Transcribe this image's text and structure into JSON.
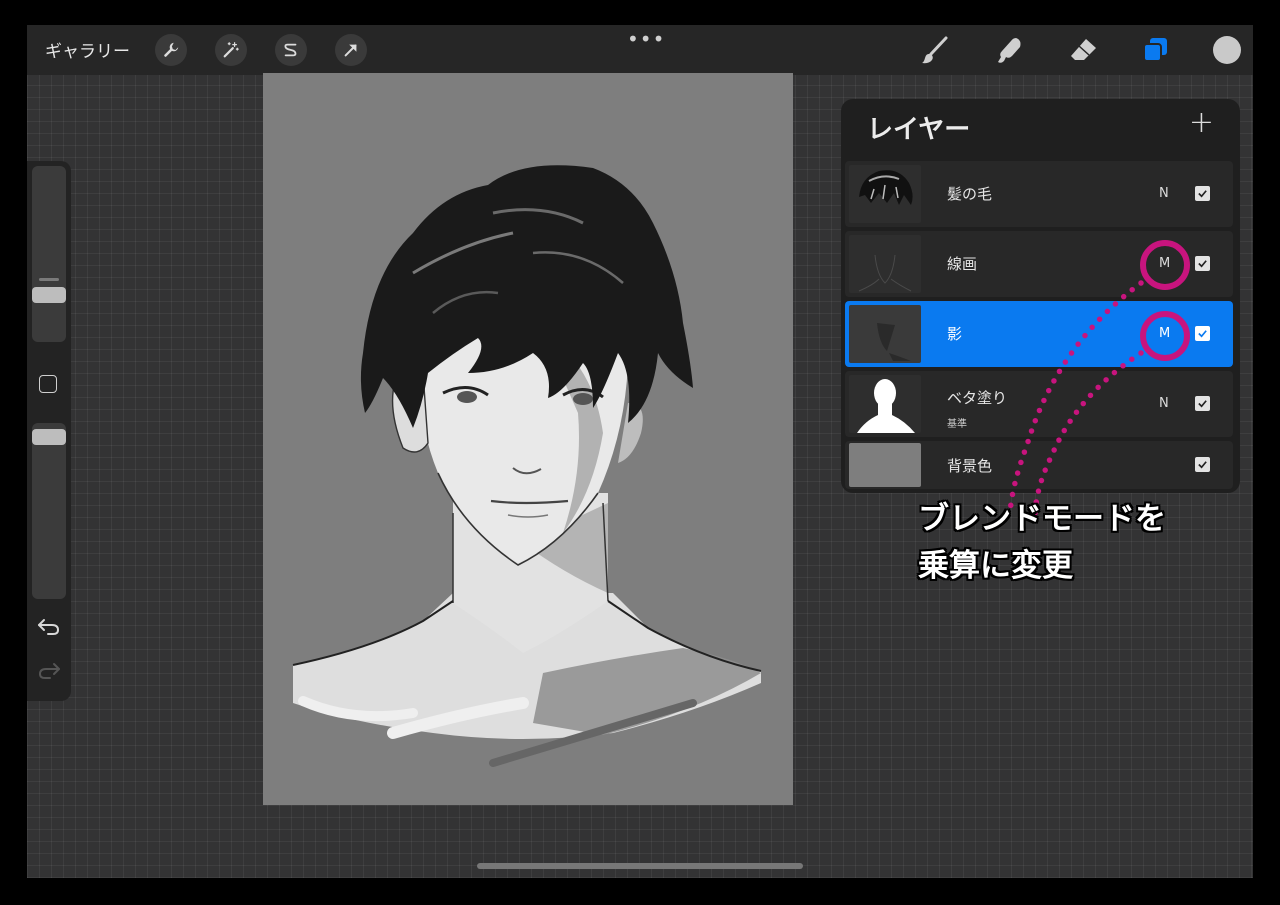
{
  "topbar": {
    "gallery_label": "ギャラリー",
    "more_label": "•••",
    "left_tools": [
      "wrench-icon",
      "magic-wand-icon",
      "selection-icon",
      "transform-arrow-icon"
    ],
    "right_tools": [
      "brush-icon",
      "smudge-icon",
      "eraser-icon",
      "layers-icon"
    ],
    "current_color": "#c9c9c9"
  },
  "layers": {
    "title": "レイヤー",
    "add_label": "+",
    "items": [
      {
        "name": "髪の毛",
        "mode": "N",
        "visible": true
      },
      {
        "name": "線画",
        "mode": "M",
        "visible": true
      },
      {
        "name": "影",
        "mode": "M",
        "visible": true,
        "active": true
      },
      {
        "name": "ベタ塗り",
        "subtitle": "基準",
        "mode": "N",
        "visible": true
      },
      {
        "name": "背景色",
        "mode": "",
        "visible": true
      }
    ]
  },
  "annotation": {
    "line1": "ブレンドモードを",
    "line2": "乗算に変更",
    "color": "#c8147e"
  },
  "colors": {
    "accent": "#0a7af0",
    "highlight": "#c8147e"
  }
}
